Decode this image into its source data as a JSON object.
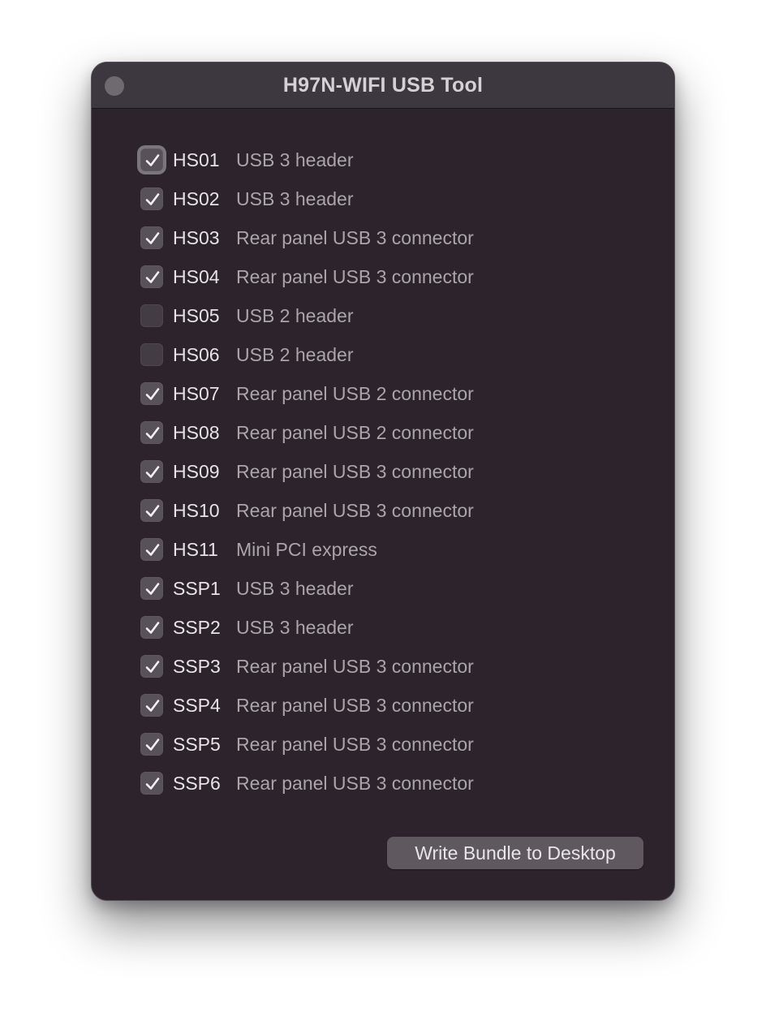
{
  "window": {
    "title": "H97N-WIFI USB Tool"
  },
  "ports": [
    {
      "name": "HS01",
      "description": "USB 3 header",
      "checked": true
    },
    {
      "name": "HS02",
      "description": "USB 3 header",
      "checked": true
    },
    {
      "name": "HS03",
      "description": "Rear panel USB 3 connector",
      "checked": true
    },
    {
      "name": "HS04",
      "description": "Rear panel USB 3 connector",
      "checked": true
    },
    {
      "name": "HS05",
      "description": "USB 2 header",
      "checked": false
    },
    {
      "name": "HS06",
      "description": "USB 2 header",
      "checked": false
    },
    {
      "name": "HS07",
      "description": "Rear panel USB 2 connector",
      "checked": true
    },
    {
      "name": "HS08",
      "description": "Rear panel USB 2 connector",
      "checked": true
    },
    {
      "name": "HS09",
      "description": "Rear panel USB 3 connector",
      "checked": true
    },
    {
      "name": "HS10",
      "description": "Rear panel USB 3 connector",
      "checked": true
    },
    {
      "name": "HS11",
      "description": "Mini PCI express",
      "checked": true
    },
    {
      "name": "SSP1",
      "description": "USB 3 header",
      "checked": true
    },
    {
      "name": "SSP2",
      "description": "USB 3 header",
      "checked": true
    },
    {
      "name": "SSP3",
      "description": "Rear panel USB 3 connector",
      "checked": true
    },
    {
      "name": "SSP4",
      "description": "Rear panel USB 3 connector",
      "checked": true
    },
    {
      "name": "SSP5",
      "description": "Rear panel USB 3 connector",
      "checked": true
    },
    {
      "name": "SSP6",
      "description": "Rear panel USB 3 connector",
      "checked": true
    }
  ],
  "actions": {
    "write_label": "Write Bundle to Desktop"
  },
  "colors": {
    "window_bg": "#2d232c",
    "titlebar_bg": "#3d3740",
    "button_bg": "#5f585f"
  }
}
